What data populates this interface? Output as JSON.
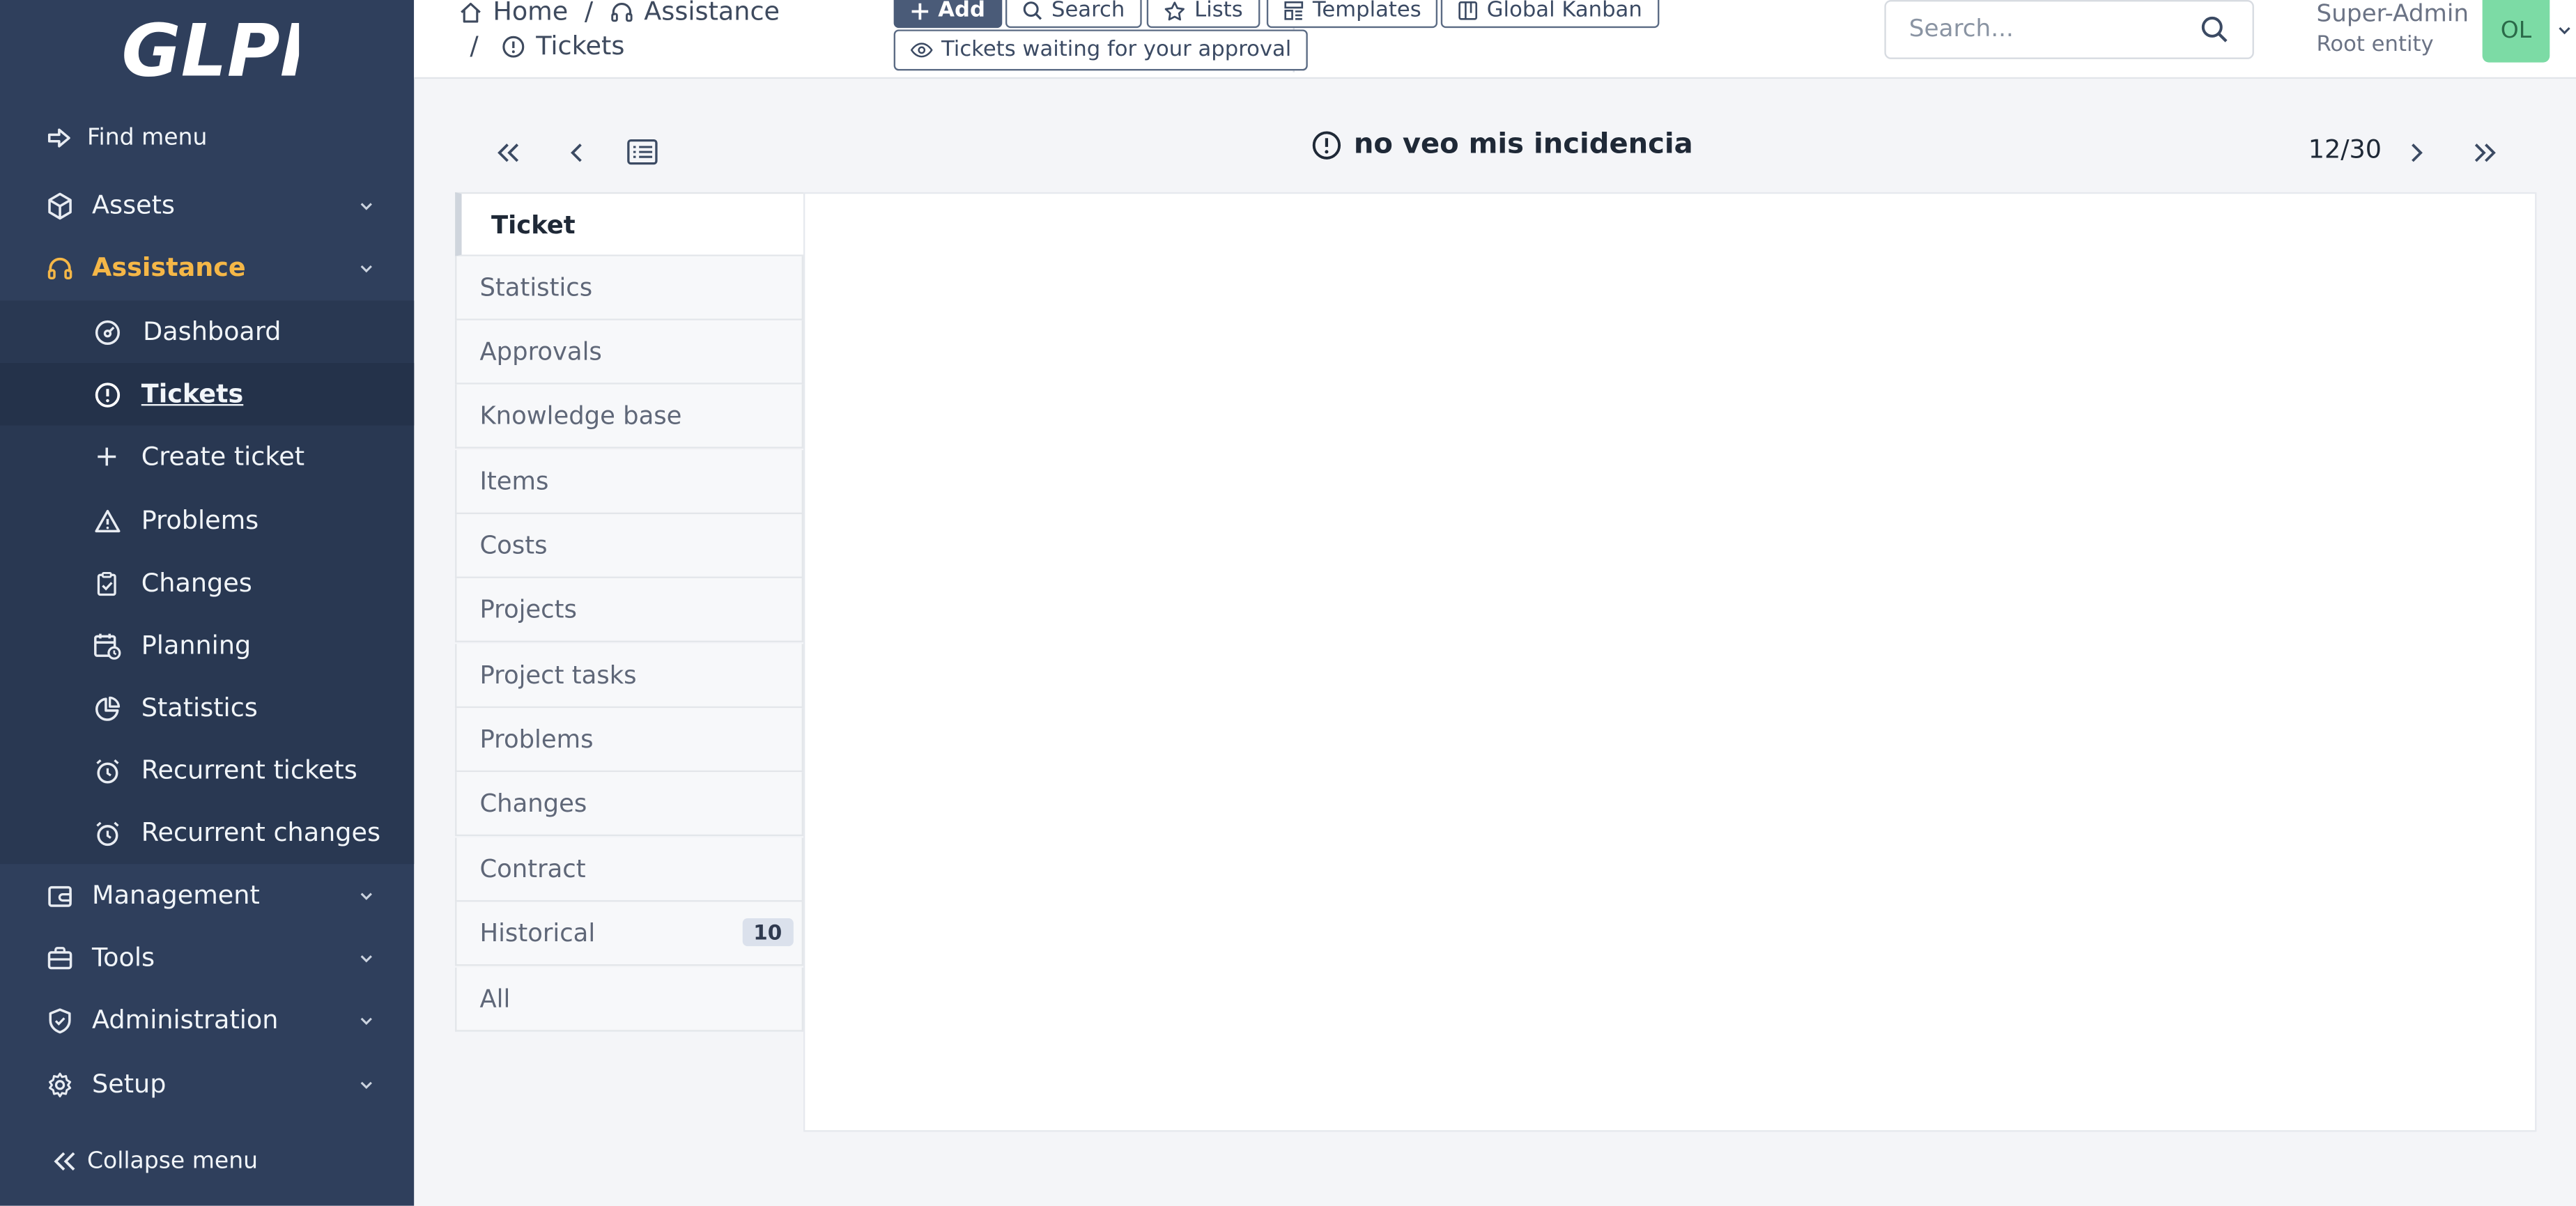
{
  "app": {
    "logo_text": "GLPI"
  },
  "sidebar": {
    "find_menu": "Find menu",
    "items": [
      {
        "label": "Assets",
        "icon": "cube-icon"
      },
      {
        "label": "Assistance",
        "icon": "headset-icon"
      },
      {
        "label": "Management",
        "icon": "wallet-icon"
      },
      {
        "label": "Tools",
        "icon": "briefcase-icon"
      },
      {
        "label": "Administration",
        "icon": "shield-icon"
      },
      {
        "label": "Setup",
        "icon": "gear-icon"
      }
    ],
    "sub_items": [
      {
        "label": "Dashboard",
        "icon": "gauge-icon"
      },
      {
        "label": "Tickets",
        "icon": "alert-circle-icon"
      },
      {
        "label": "Create ticket",
        "icon": "plus-icon"
      },
      {
        "label": "Problems",
        "icon": "warning-triangle-icon"
      },
      {
        "label": "Changes",
        "icon": "clipboard-check-icon"
      },
      {
        "label": "Planning",
        "icon": "calendar-clock-icon"
      },
      {
        "label": "Statistics",
        "icon": "pie-chart-icon"
      },
      {
        "label": "Recurrent tickets",
        "icon": "alarm-clock-icon"
      },
      {
        "label": "Recurrent changes",
        "icon": "alarm-clock-icon"
      }
    ],
    "collapse": "Collapse menu",
    "accent": "#f5b747"
  },
  "header": {
    "breadcrumb": {
      "home": "Home",
      "section": "Assistance",
      "page": "Tickets"
    },
    "buttons": {
      "add": "Add",
      "search": "Search",
      "lists": "Lists",
      "templates": "Templates",
      "kanban": "Global Kanban",
      "approval": "Tickets waiting for your approval"
    },
    "search_placeholder": "Search...",
    "user": {
      "name": "Super-Admin",
      "entity": "Root entity",
      "initials": "OL"
    }
  },
  "main": {
    "title": "no veo mis incidencia",
    "counter": "12/30",
    "tabs": [
      {
        "label": "Ticket"
      },
      {
        "label": "Statistics"
      },
      {
        "label": "Approvals"
      },
      {
        "label": "Knowledge base"
      },
      {
        "label": "Items"
      },
      {
        "label": "Costs"
      },
      {
        "label": "Projects"
      },
      {
        "label": "Project tasks"
      },
      {
        "label": "Problems"
      },
      {
        "label": "Changes"
      },
      {
        "label": "Contract"
      },
      {
        "label": "Historical",
        "badge": "10"
      },
      {
        "label": "All"
      }
    ]
  }
}
